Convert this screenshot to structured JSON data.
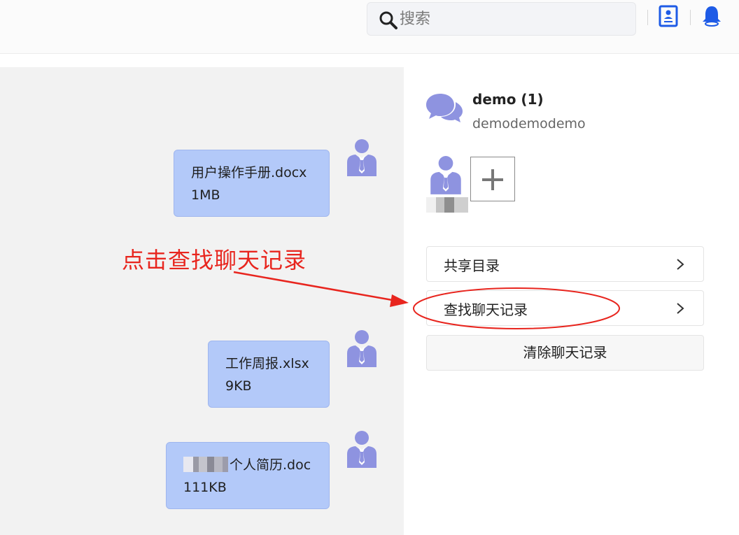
{
  "search": {
    "placeholder": "搜索"
  },
  "chat": {
    "messages": [
      {
        "filename": "用户操作手册.docx",
        "size": "1MB"
      },
      {
        "filename": "工作周报.xlsx",
        "size": "9KB"
      },
      {
        "filename": "个人简历.doc",
        "size": "111KB"
      }
    ]
  },
  "annotation": {
    "text": "点击查找聊天记录",
    "color": "#e8251e"
  },
  "group": {
    "name": "demo (1)",
    "description": "demodemodemo"
  },
  "menu": {
    "shared_directory": "共享目录",
    "find_chat_history": "查找聊天记录",
    "clear_chat_history": "清除聊天记录"
  },
  "colors": {
    "accent": "#1e5be6",
    "avatar": "#8e93e0",
    "bubble": "#b3c9f9"
  },
  "icons": [
    "search-icon",
    "contacts-icon",
    "bell-icon",
    "user-avatar-icon",
    "chat-bubbles-icon",
    "plus-icon",
    "chevron-right-icon"
  ]
}
